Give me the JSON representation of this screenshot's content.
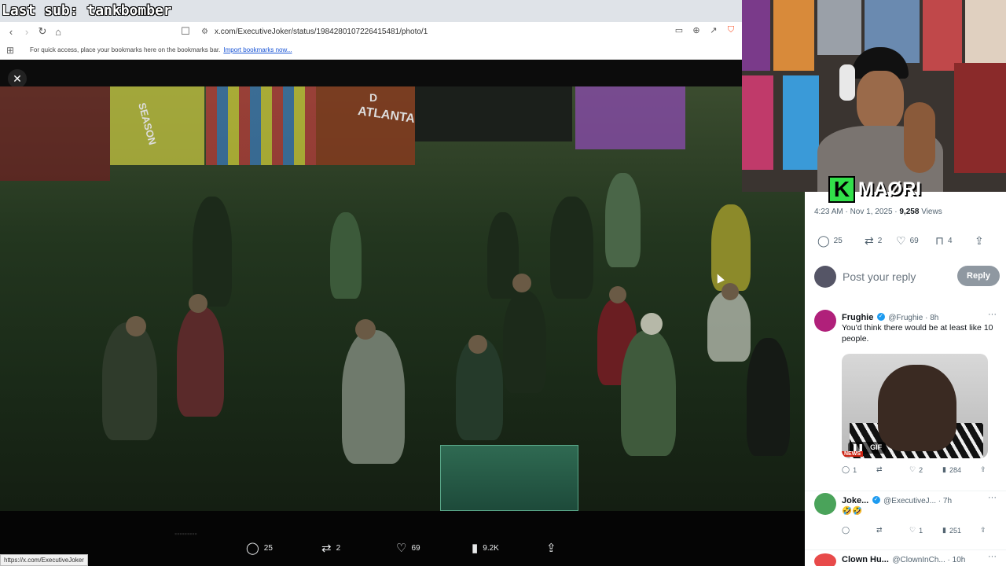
{
  "stream_overlay": {
    "last_sub": "Last sub: tankbomber"
  },
  "browser": {
    "url": "x.com/ExecutiveJoker/status/1984280107226415481/photo/1",
    "bookmarks_hint": "For quick access, place your bookmarks here on the bookmarks bar.",
    "import_link": "Import bookmarks now...",
    "status_url": "https://x.com/ExecutiveJoker"
  },
  "photo": {
    "scene_signs": [
      "ATLANTA",
      "SEASON",
      "D"
    ],
    "actions": [
      {
        "icon": "reply-icon",
        "count": "25"
      },
      {
        "icon": "repost-icon",
        "count": "2"
      },
      {
        "icon": "like-icon",
        "count": "69"
      },
      {
        "icon": "views-icon",
        "count": "9.2K"
      },
      {
        "icon": "share-icon",
        "count": ""
      }
    ]
  },
  "tweet": {
    "time": "4:23 AM · Nov 1, 2025 ·",
    "views_count": "9,258",
    "views_label": "Views",
    "stats": {
      "replies": "25",
      "reposts": "2",
      "likes": "69",
      "bookmarks": "4"
    }
  },
  "reply_composer": {
    "placeholder": "Post your reply",
    "button": "Reply"
  },
  "comments": [
    {
      "name": "Frughie",
      "handle": "@Frughie · 8h",
      "text": "You'd think there would be at least like 10 people.",
      "gif_label": "GIF",
      "gif_news": "NEWS",
      "replies": "1",
      "reposts": "",
      "likes": "2",
      "views": "284"
    },
    {
      "name": "Joke...",
      "handle": "@ExecutiveJ... · 7h",
      "text": "🤣🤣",
      "replies": "",
      "reposts": "",
      "likes": "1",
      "views": "251"
    },
    {
      "name": "Clown Hu...",
      "handle": "@ClownInCh... · 10h"
    }
  ],
  "webcam": {
    "logo_letter": "K",
    "logo_text": "MAØRI"
  },
  "colors": {
    "accent": "#1d9bf0",
    "logo_green": "#32e04a",
    "reply_button": "#8f98a1"
  }
}
